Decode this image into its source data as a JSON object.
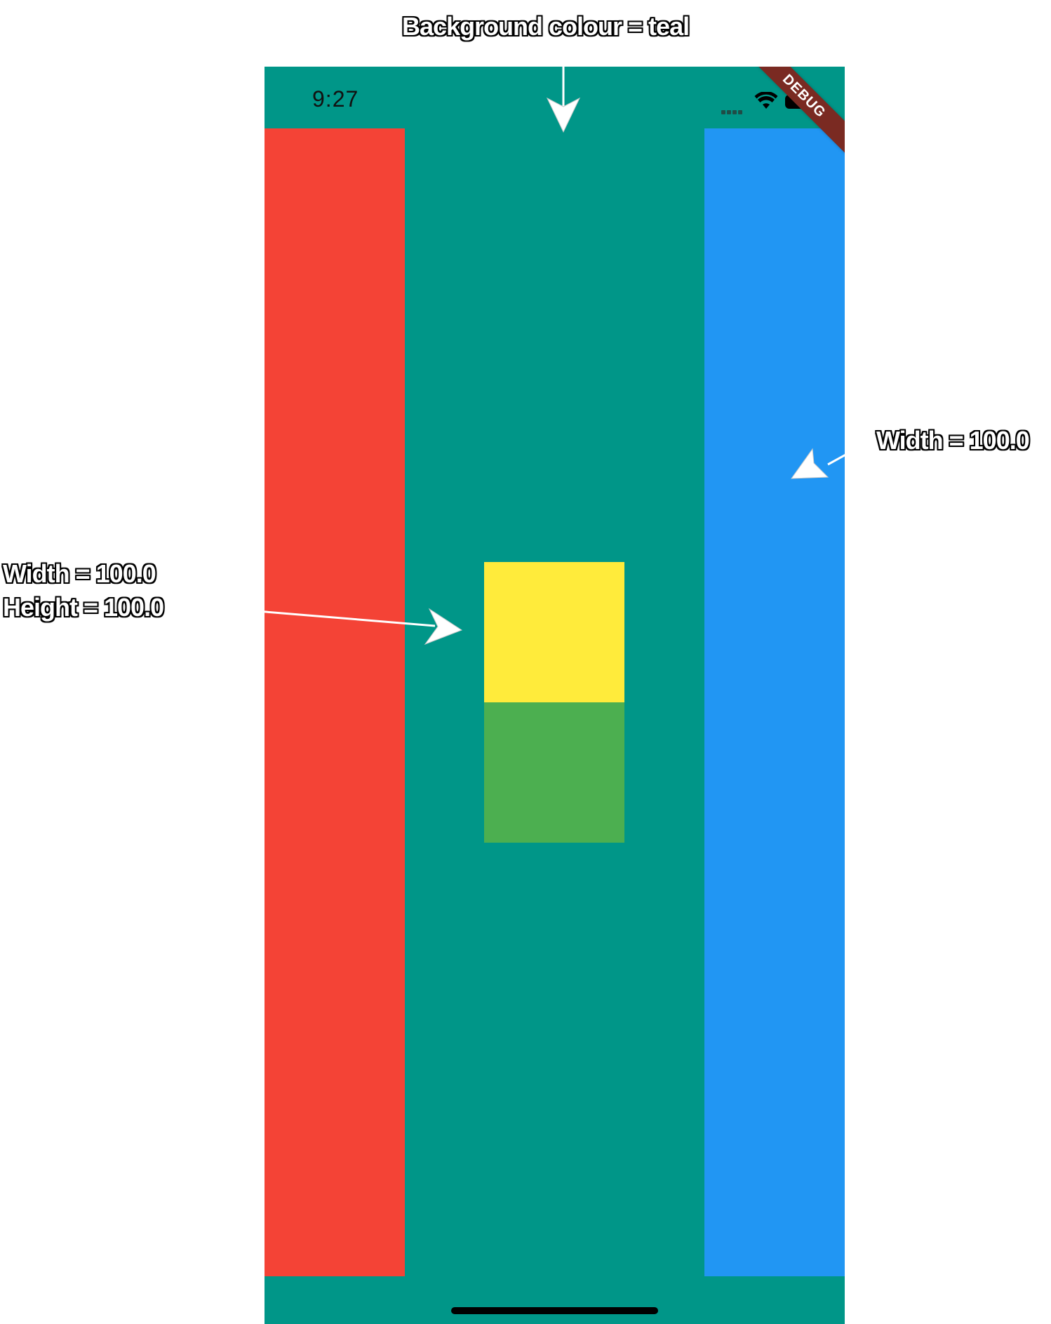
{
  "annotations": {
    "background": "Background colour = teal",
    "blue_width": "Width = 100.0",
    "yellow_width": "Width = 100.0",
    "yellow_height": "Height = 100.0"
  },
  "status_bar": {
    "time": "9:27",
    "icons": [
      "cellular-signal-icon",
      "wifi-icon",
      "battery-icon"
    ]
  },
  "debug_banner": "DEBUG",
  "colors": {
    "background": "#009688",
    "left_column": "#F44336",
    "right_column": "#2196F3",
    "yellow_box": "#FFEB3B",
    "green_box": "#4CAF50"
  }
}
